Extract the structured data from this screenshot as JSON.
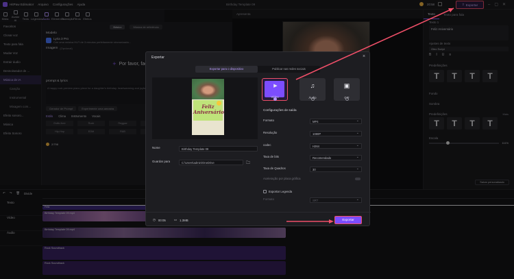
{
  "app": {
    "name": "HitPaw Edimakor",
    "menu": [
      "Arquivo",
      "Configurações",
      "Ajuda"
    ],
    "document_title": "Birthday Template 09",
    "export_label": "Exportar",
    "zoom": "20:58"
  },
  "toolbar": {
    "items": [
      "Mídia",
      "Avatar AI",
      "Texto",
      "Legendas",
      "Áudio",
      "Elementos",
      "Transição",
      "Filtros",
      "Efeitos"
    ],
    "active": "Áudio"
  },
  "sidebar": {
    "items": [
      "Favoritos",
      "Clonar voz",
      "Texto para fala",
      "Mudar Voz",
      "Extrair áudio",
      "Desnoiseador de ...",
      "Música de IA",
      "Canção",
      "Instrumental",
      "Mixagem com...",
      "Efeito sonoro...",
      "Música",
      "Efeito Sonoro"
    ],
    "selected": "Música de IA",
    "subitems": [
      "Canção",
      "Instrumental",
      "Mixagem com..."
    ]
  },
  "ai_panel": {
    "tabs": [
      "Básico",
      "Música de referência"
    ],
    "model_heading": "Modelo",
    "model_name": "Lyria 3 Pro",
    "model_desc": "Crie uma música Hi-Fi de 3 minutos perfeitamente sincronizada...",
    "image_heading": "Imagem",
    "image_optional": "(Opcional)",
    "image_placeholder": "Por favor, faça o upl",
    "prompt_heading": "prompt & lyrics",
    "prompt_text": "A happy rock preview piano piece for a daughter's birthday, heartwarming and joyful...",
    "prompt_chips": [
      "Gerador de Prompt",
      "Experimente uma amostra"
    ],
    "style_tabs": [
      "Estilo",
      "Clima",
      "Instrumento",
      "Vocais"
    ],
    "styles": [
      "Estilo livre",
      "Rock",
      "Reggae",
      "Eletrônico",
      "Hip-Hop",
      "EDM",
      "R&B",
      "Blues"
    ],
    "credits": "2/798"
  },
  "preview": {
    "header": "Apresenta"
  },
  "right_panel": {
    "tabs": [
      "Texto",
      "Texto para fala"
    ],
    "labels": [
      "Texto 1",
      "Ajustes de texto",
      "Predefinições",
      "Fundo",
      "Sombra",
      "Predefinições",
      "Escala"
    ],
    "text_preview": "Feliz Aniversário",
    "font": "Oleo Script",
    "more": "Mais",
    "custom_btn": "Salvar personalizado",
    "scale_value": "111%"
  },
  "timeline": {
    "track_labels": [
      "Divide",
      "Texto",
      "Vídeo",
      "Áudio"
    ],
    "clips": [
      "Feliz",
      "Birthday Template 09.mp4",
      "Rock Soundtrack",
      "Rock Soundtrack"
    ]
  },
  "export_dialog": {
    "title": "Exportar",
    "tabs": [
      "Exportar para o dispositivo",
      "Publicar nas redes sociais"
    ],
    "active_tab": "Exportar para o dispositivo",
    "preview_text": "Feliz Aniversário",
    "name_label": "Nome",
    "name_value": "Birthday Template 09",
    "save_label": "Guardar para",
    "save_value": "C:\\Users\\admin\\OneDrive",
    "formats": [
      "Vídeo",
      "Áudio",
      "GIF"
    ],
    "selected_format": "Vídeo",
    "settings_heading": "Configurações de saída",
    "settings": [
      {
        "label": "Formato",
        "value": "MP4"
      },
      {
        "label": "Resolução",
        "value": "1080P"
      },
      {
        "label": "codec",
        "value": "H264"
      },
      {
        "label": "Taxa de bits",
        "value": "Recomendado"
      },
      {
        "label": "Taxa de Quadros",
        "value": "30"
      }
    ],
    "gpu_label": "Aceleração por placa gráfica",
    "subtitle_label": "Exportar Legenda",
    "subtitle_format_label": "Formato",
    "subtitle_format_value": "SRT",
    "duration": "00:05",
    "size": "1.3MB",
    "export_button": "Exportar"
  },
  "colors": {
    "accent": "#7c4dff",
    "highlight": "#ef4f68",
    "background": "#141416"
  }
}
